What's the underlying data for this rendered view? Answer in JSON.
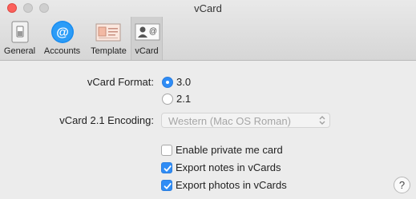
{
  "window": {
    "title": "vCard"
  },
  "tabs": [
    {
      "label": "General",
      "icon": "general-switch-icon",
      "active": false
    },
    {
      "label": "Accounts",
      "icon": "at-sign-icon",
      "active": false
    },
    {
      "label": "Template",
      "icon": "template-card-icon",
      "active": false
    },
    {
      "label": "vCard",
      "icon": "vcard-icon",
      "active": true
    }
  ],
  "format": {
    "label": "vCard Format:",
    "options": [
      {
        "label": "3.0",
        "selected": true
      },
      {
        "label": "2.1",
        "selected": false
      }
    ]
  },
  "encoding": {
    "label": "vCard 2.1 Encoding:",
    "value": "Western (Mac OS Roman)",
    "enabled": false
  },
  "checkboxes": [
    {
      "label": "Enable private me card",
      "checked": false
    },
    {
      "label": "Export notes in vCards",
      "checked": true
    },
    {
      "label": "Export photos in vCards",
      "checked": true
    }
  ],
  "help": {
    "label": "?"
  },
  "colors": {
    "accent": "#2f8cf5",
    "toolbar": "#dcdcdc",
    "background": "#ececec"
  }
}
